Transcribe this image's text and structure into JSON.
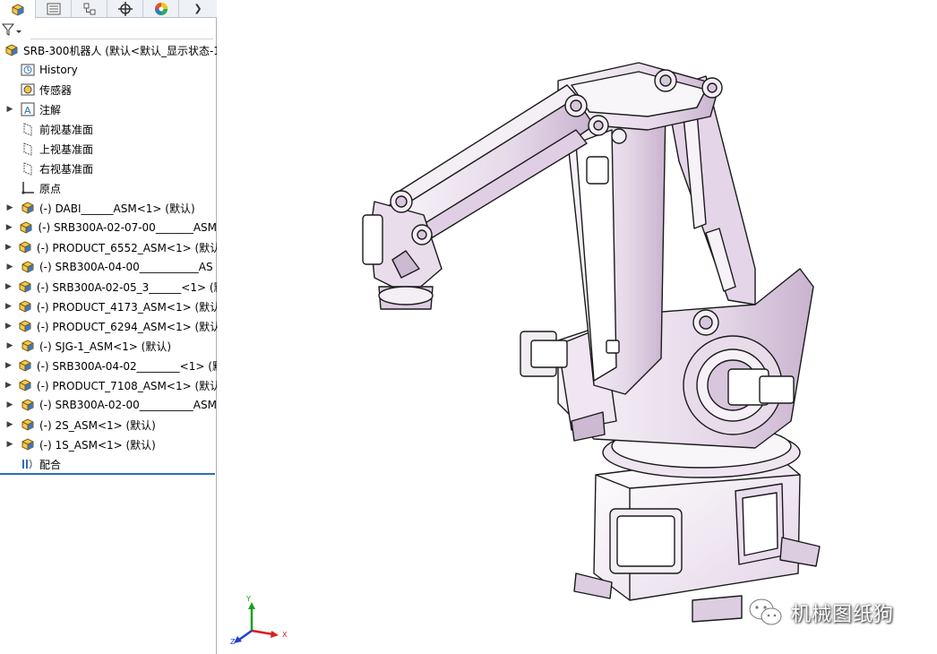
{
  "panel": {
    "tabs": [
      {
        "icon": "feature-manager-icon",
        "active": true
      },
      {
        "icon": "property-manager-icon",
        "active": false
      },
      {
        "icon": "configuration-manager-icon",
        "active": false
      },
      {
        "icon": "dimxpert-icon",
        "active": false
      },
      {
        "icon": "display-manager-icon",
        "active": false
      }
    ],
    "tab_overflow_icon": "chevron-right-icon",
    "filter_icon": "filter-icon"
  },
  "tree": {
    "root": {
      "label": "SRB-300机器人  (默认<默认_显示状态-1",
      "icon": "assembly-icon"
    },
    "items": [
      {
        "label": "History",
        "icon": "history-icon",
        "expandable": false
      },
      {
        "label": "传感器",
        "icon": "sensor-icon",
        "expandable": false
      },
      {
        "label": "注解",
        "icon": "annotation-icon",
        "expandable": true
      },
      {
        "label": "前视基准面",
        "icon": "plane-icon",
        "expandable": false
      },
      {
        "label": "上视基准面",
        "icon": "plane-icon",
        "expandable": false
      },
      {
        "label": "右视基准面",
        "icon": "plane-icon",
        "expandable": false
      },
      {
        "label": "原点",
        "icon": "origin-icon",
        "expandable": false
      },
      {
        "label": "(-) DABI______ASM<1> (默认)",
        "icon": "subassembly-icon",
        "expandable": true
      },
      {
        "label": "(-) SRB300A-02-07-00_______ASM",
        "icon": "subassembly-icon",
        "expandable": true
      },
      {
        "label": "(-) PRODUCT_6552_ASM<1> (默认",
        "icon": "subassembly-icon",
        "expandable": true
      },
      {
        "label": "(-) SRB300A-04-00___________AS",
        "icon": "subassembly-icon",
        "expandable": true
      },
      {
        "label": "(-) SRB300A-02-05_3______<1> (默",
        "icon": "subassembly-icon",
        "expandable": true
      },
      {
        "label": "(-) PRODUCT_4173_ASM<1> (默认",
        "icon": "subassembly-icon",
        "expandable": true
      },
      {
        "label": "(-) PRODUCT_6294_ASM<1> (默认",
        "icon": "subassembly-icon",
        "expandable": true
      },
      {
        "label": "(-) SJG-1_ASM<1> (默认)",
        "icon": "subassembly-icon",
        "expandable": true
      },
      {
        "label": "(-) SRB300A-04-02________<1> (默",
        "icon": "subassembly-icon",
        "expandable": true
      },
      {
        "label": "(-) PRODUCT_7108_ASM<1> (默认",
        "icon": "subassembly-icon",
        "expandable": true
      },
      {
        "label": "(-) SRB300A-02-00__________ASM",
        "icon": "subassembly-icon",
        "expandable": true
      },
      {
        "label": "(-) 2S_ASM<1> (默认)",
        "icon": "subassembly-icon",
        "expandable": true
      },
      {
        "label": "(-) 1S_ASM<1> (默认)",
        "icon": "subassembly-icon",
        "expandable": true
      },
      {
        "label": "配合",
        "icon": "mates-icon",
        "expandable": false
      }
    ]
  },
  "viewport": {
    "model_icon": "robot-arm-model",
    "triad": {
      "x": "X",
      "y": "Y",
      "z": "Z"
    },
    "watermark": "机械图纸狗",
    "watermark_icon": "wechat-icon"
  },
  "colors": {
    "accent": "#2e6fb7",
    "robot_shade": "#d9c8dd",
    "robot_highlight": "#f6f1f7",
    "axis_x": "#d62020",
    "axis_y": "#1aa31a",
    "axis_z": "#2040d0"
  }
}
